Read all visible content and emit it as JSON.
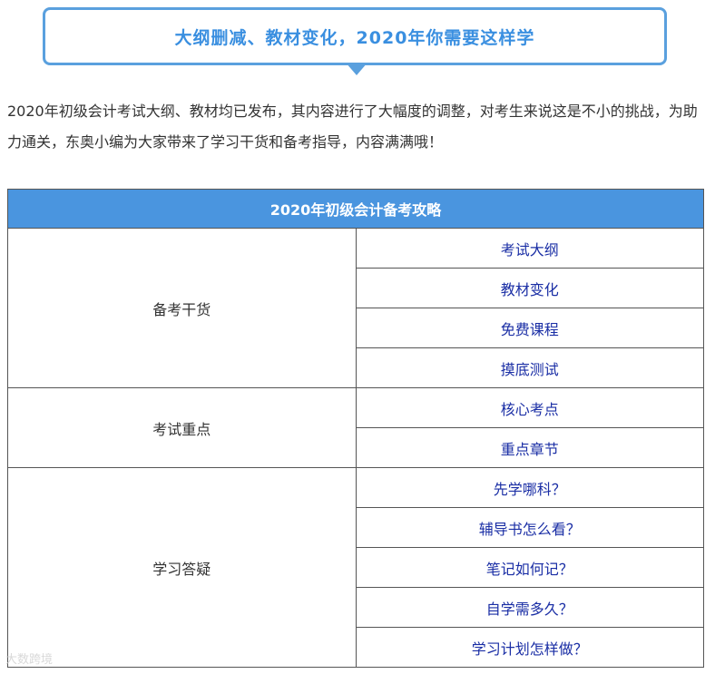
{
  "banner": {
    "title": "大纲删减、教材变化，2020年你需要这样学"
  },
  "intro": "2020年初级会计考试大纲、教材均已发布，其内容进行了大幅度的调整，对考生来说这是不小的挑战，为助力通关，东奥小编为大家带来了学习干货和备考指导，内容满满哦！",
  "table": {
    "header": "2020年初级会计备考攻略",
    "groups": [
      {
        "category": "备考干货",
        "items": [
          "考试大纲",
          "教材变化",
          "免费课程",
          "摸底测试"
        ]
      },
      {
        "category": "考试重点",
        "items": [
          "核心考点",
          "重点章节"
        ]
      },
      {
        "category": "学习答疑",
        "items": [
          "先学哪科？",
          "辅导书怎么看？",
          "笔记如何记？",
          "自学需多久？",
          "学习计划怎样做？"
        ]
      }
    ]
  },
  "watermark": "大数跨境",
  "colors": {
    "accent": "#4a95df",
    "banner_border": "#5aa0de",
    "link": "#1a2ea5"
  }
}
